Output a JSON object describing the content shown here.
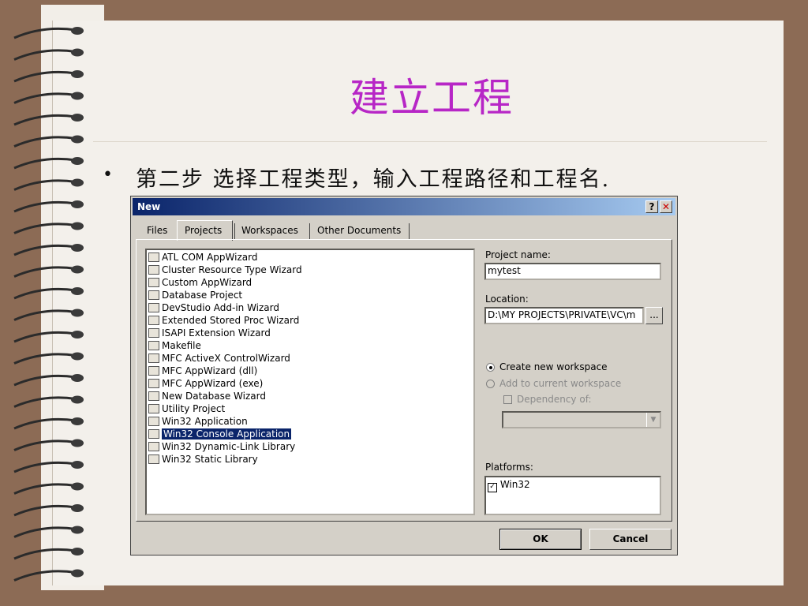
{
  "slide": {
    "title": "建立工程",
    "bullet_symbol": "•",
    "bullet_text": "第二步 选择工程类型，输入工程路径和工程名."
  },
  "dialog": {
    "title": "New",
    "help_glyph": "?",
    "close_glyph": "✕",
    "tabs": [
      "Files",
      "Projects",
      "Workspaces",
      "Other Documents"
    ],
    "active_tab": "Projects",
    "project_types": [
      {
        "label": "ATL COM AppWizard",
        "icon": "atl-icon"
      },
      {
        "label": "Cluster Resource Type Wizard",
        "icon": "cluster-icon"
      },
      {
        "label": "Custom AppWizard",
        "icon": "custom-wizard-icon"
      },
      {
        "label": "Database Project",
        "icon": "database-icon"
      },
      {
        "label": "DevStudio Add-in Wizard",
        "icon": "addin-icon"
      },
      {
        "label": "Extended Stored Proc Wizard",
        "icon": "stored-proc-icon"
      },
      {
        "label": "ISAPI Extension Wizard",
        "icon": "globe-icon"
      },
      {
        "label": "Makefile",
        "icon": "makefile-icon"
      },
      {
        "label": "MFC ActiveX ControlWizard",
        "icon": "activex-icon"
      },
      {
        "label": "MFC AppWizard (dll)",
        "icon": "mfc-dll-icon"
      },
      {
        "label": "MFC AppWizard (exe)",
        "icon": "mfc-exe-icon"
      },
      {
        "label": "New Database Wizard",
        "icon": "db-wizard-icon"
      },
      {
        "label": "Utility Project",
        "icon": "utility-icon"
      },
      {
        "label": "Win32 Application",
        "icon": "win32-app-icon"
      },
      {
        "label": "Win32 Console Application",
        "icon": "console-icon"
      },
      {
        "label": "Win32 Dynamic-Link Library",
        "icon": "dll-icon"
      },
      {
        "label": "Win32 Static Library",
        "icon": "static-lib-icon"
      }
    ],
    "selected_project_type": "Win32 Console Application",
    "project_name_label": "Project name:",
    "project_name_value": "mytest",
    "location_label": "Location:",
    "location_value": "D:\\MY PROJECTS\\PRIVATE\\VC\\m",
    "browse_label": "...",
    "create_workspace_label": "Create new workspace",
    "add_workspace_label": "Add to current workspace",
    "dependency_label": "Dependency of:",
    "platforms_label": "Platforms:",
    "platforms": [
      "Win32"
    ],
    "ok_label": "OK",
    "cancel_label": "Cancel"
  },
  "colors": {
    "title_color": "#b726c6",
    "titlebar_start": "#0a246a",
    "titlebar_end": "#a6caf0",
    "selection": "#0a246a",
    "dialog_face": "#d4d0c8"
  }
}
